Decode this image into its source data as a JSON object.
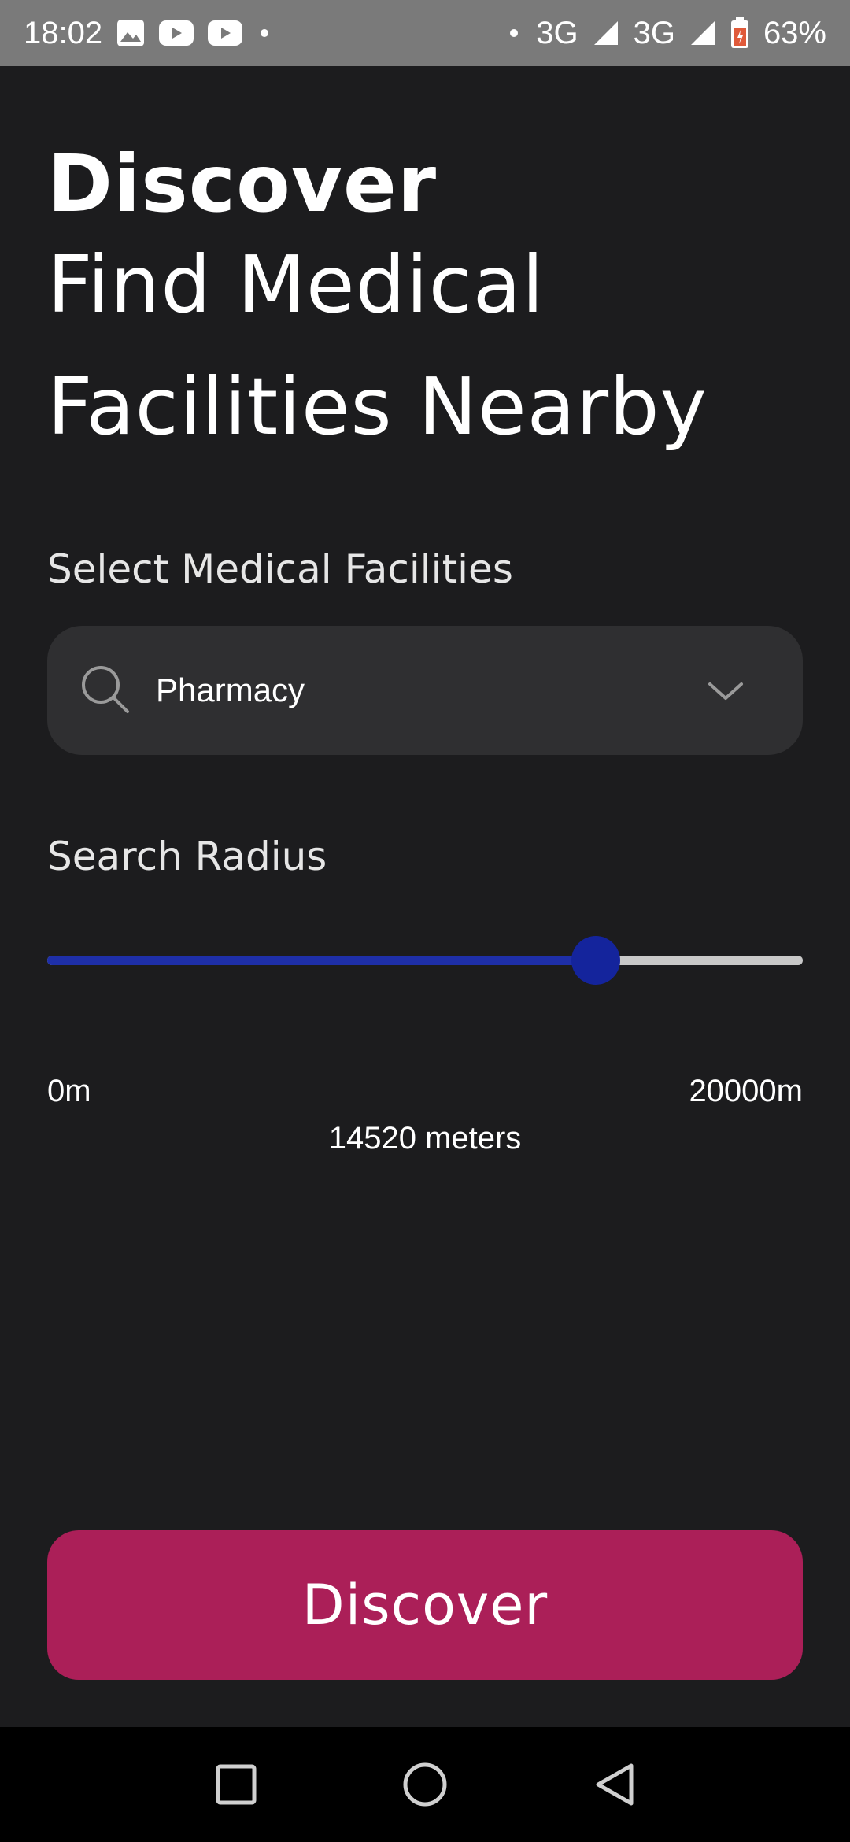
{
  "status_bar": {
    "time": "18:02",
    "network_1": "3G",
    "network_2": "3G",
    "battery": "63%"
  },
  "header": {
    "title": "Discover",
    "subtitle": "Find Medical Facilities Nearby"
  },
  "facility": {
    "label": "Select Medical Facilities",
    "selected": "Pharmacy"
  },
  "radius": {
    "label": "Search Radius",
    "min_label": "0m",
    "max_label": "20000m",
    "min": 0,
    "max": 20000,
    "value": 14520,
    "value_text": "14520 meters"
  },
  "actions": {
    "discover_label": "Discover"
  },
  "colors": {
    "background": "#1c1c1e",
    "select_bg": "#2f2f31",
    "slider_active": "#1e2fa8",
    "slider_inactive": "#c8c8c8",
    "button": "#ab1f58"
  },
  "icons": {
    "search": "search-icon",
    "dropdown": "chevron-down-icon",
    "nav_recents": "square-icon",
    "nav_home": "circle-icon",
    "nav_back": "triangle-back-icon"
  }
}
